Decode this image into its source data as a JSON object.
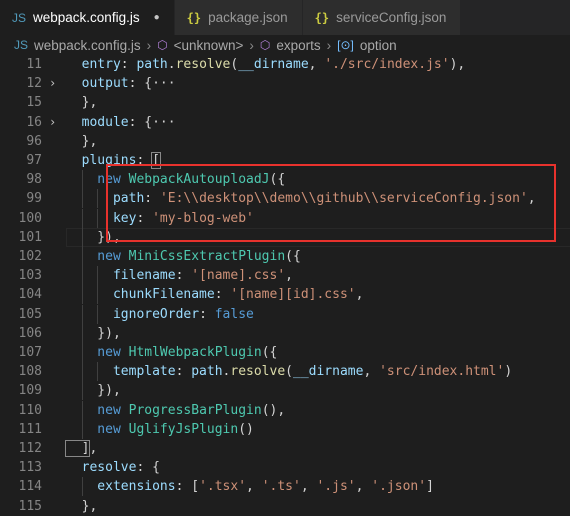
{
  "tabs": [
    {
      "label": "webpack.config.js",
      "icon": "JS",
      "icon_name": "js-file-icon",
      "dirty": "●",
      "active": true
    },
    {
      "label": "package.json",
      "icon": "{}",
      "icon_name": "json-file-icon",
      "active": false
    },
    {
      "label": "serviceConfig.json",
      "icon": "{}",
      "icon_name": "json-file-icon",
      "active": false
    }
  ],
  "breadcrumb": {
    "file": "webpack.config.js",
    "sep": "›",
    "unknown": "<unknown>",
    "exports": "exports",
    "option": "option",
    "js_icon": "JS"
  },
  "lines": [
    {
      "n": "11",
      "fold": "",
      "indent": 0,
      "tokens": [
        [
          "p",
          "  entry"
        ],
        [
          "punc",
          ": "
        ],
        [
          "p",
          "path"
        ],
        [
          "punc",
          "."
        ],
        [
          "f",
          "resolve"
        ],
        [
          "punc",
          "("
        ],
        [
          "p",
          "__dirname"
        ],
        [
          "punc",
          ", "
        ],
        [
          "s",
          "'./src/index.js'"
        ],
        [
          "punc",
          "),"
        ]
      ]
    },
    {
      "n": "12",
      "fold": "›",
      "indent": 0,
      "tokens": [
        [
          "p",
          "  output"
        ],
        [
          "punc",
          ": {···"
        ]
      ]
    },
    {
      "n": "15",
      "fold": "",
      "indent": 0,
      "tokens": [
        [
          "punc",
          "  },"
        ]
      ]
    },
    {
      "n": "16",
      "fold": "›",
      "indent": 0,
      "tokens": [
        [
          "p",
          "  module"
        ],
        [
          "punc",
          ": {···"
        ]
      ]
    },
    {
      "n": "96",
      "fold": "",
      "indent": 0,
      "tokens": [
        [
          "punc",
          "  },"
        ]
      ]
    },
    {
      "n": "97",
      "fold": "",
      "indent": 0,
      "tokens": [
        [
          "p",
          "  plugins"
        ],
        [
          "punc",
          ": "
        ],
        [
          "bm",
          "["
        ]
      ]
    },
    {
      "n": "98",
      "fold": "",
      "indent": 1,
      "tokens": [
        [
          "k",
          "    new "
        ],
        [
          "c",
          "WebpackAutouploadJ"
        ],
        [
          "punc",
          "({"
        ]
      ]
    },
    {
      "n": "99",
      "fold": "",
      "indent": 2,
      "tokens": [
        [
          "p",
          "      path"
        ],
        [
          "punc",
          ": "
        ],
        [
          "s",
          "'E:\\\\desktop\\\\demo\\\\github\\\\serviceConfig.json'"
        ],
        [
          "punc",
          ","
        ]
      ]
    },
    {
      "n": "100",
      "fold": "",
      "indent": 2,
      "tokens": [
        [
          "p",
          "      key"
        ],
        [
          "punc",
          ": "
        ],
        [
          "s",
          "'my-blog-web'"
        ]
      ]
    },
    {
      "n": "101",
      "fold": "",
      "indent": 1,
      "current": true,
      "tokens": [
        [
          "punc",
          "    }),"
        ]
      ]
    },
    {
      "n": "102",
      "fold": "",
      "indent": 1,
      "tokens": [
        [
          "k",
          "    new "
        ],
        [
          "c",
          "MiniCssExtractPlugin"
        ],
        [
          "punc",
          "({"
        ]
      ]
    },
    {
      "n": "103",
      "fold": "",
      "indent": 2,
      "tokens": [
        [
          "p",
          "      filename"
        ],
        [
          "punc",
          ": "
        ],
        [
          "s",
          "'[name].css'"
        ],
        [
          "punc",
          ","
        ]
      ]
    },
    {
      "n": "104",
      "fold": "",
      "indent": 2,
      "tokens": [
        [
          "p",
          "      chunkFilename"
        ],
        [
          "punc",
          ": "
        ],
        [
          "s",
          "'[name][id].css'"
        ],
        [
          "punc",
          ","
        ]
      ]
    },
    {
      "n": "105",
      "fold": "",
      "indent": 2,
      "tokens": [
        [
          "p",
          "      ignoreOrder"
        ],
        [
          "punc",
          ": "
        ],
        [
          "k",
          "false"
        ]
      ]
    },
    {
      "n": "106",
      "fold": "",
      "indent": 1,
      "tokens": [
        [
          "punc",
          "    }),"
        ]
      ]
    },
    {
      "n": "107",
      "fold": "",
      "indent": 1,
      "tokens": [
        [
          "k",
          "    new "
        ],
        [
          "c",
          "HtmlWebpackPlugin"
        ],
        [
          "punc",
          "({"
        ]
      ]
    },
    {
      "n": "108",
      "fold": "",
      "indent": 2,
      "tokens": [
        [
          "p",
          "      template"
        ],
        [
          "punc",
          ": "
        ],
        [
          "p",
          "path"
        ],
        [
          "punc",
          "."
        ],
        [
          "f",
          "resolve"
        ],
        [
          "punc",
          "("
        ],
        [
          "p",
          "__dirname"
        ],
        [
          "punc",
          ", "
        ],
        [
          "s",
          "'src/index.html'"
        ],
        [
          "punc",
          ")"
        ]
      ]
    },
    {
      "n": "109",
      "fold": "",
      "indent": 1,
      "tokens": [
        [
          "punc",
          "    }),"
        ]
      ]
    },
    {
      "n": "110",
      "fold": "",
      "indent": 1,
      "tokens": [
        [
          "k",
          "    new "
        ],
        [
          "c",
          "ProgressBarPlugin"
        ],
        [
          "punc",
          "(),"
        ]
      ]
    },
    {
      "n": "111",
      "fold": "",
      "indent": 1,
      "tokens": [
        [
          "k",
          "    new "
        ],
        [
          "c",
          "UglifyJsPlugin"
        ],
        [
          "punc",
          "()"
        ]
      ]
    },
    {
      "n": "112",
      "fold": "",
      "indent": 0,
      "tokens": [
        [
          "bm",
          "  ]"
        ],
        [
          "punc",
          ","
        ]
      ]
    },
    {
      "n": "113",
      "fold": "",
      "indent": 0,
      "tokens": [
        [
          "p",
          "  resolve"
        ],
        [
          "punc",
          ": {"
        ]
      ]
    },
    {
      "n": "114",
      "fold": "",
      "indent": 1,
      "tokens": [
        [
          "p",
          "    extensions"
        ],
        [
          "punc",
          ": ["
        ],
        [
          "s",
          "'.tsx'"
        ],
        [
          "punc",
          ", "
        ],
        [
          "s",
          "'.ts'"
        ],
        [
          "punc",
          ", "
        ],
        [
          "s",
          "'.js'"
        ],
        [
          "punc",
          ", "
        ],
        [
          "s",
          "'.json'"
        ],
        [
          "punc",
          "]"
        ]
      ]
    },
    {
      "n": "115",
      "fold": "",
      "indent": 0,
      "tokens": [
        [
          "punc",
          "  },"
        ]
      ]
    }
  ],
  "colors": {
    "highlight_box": "#e8322d",
    "background": "#1e1e1e"
  }
}
